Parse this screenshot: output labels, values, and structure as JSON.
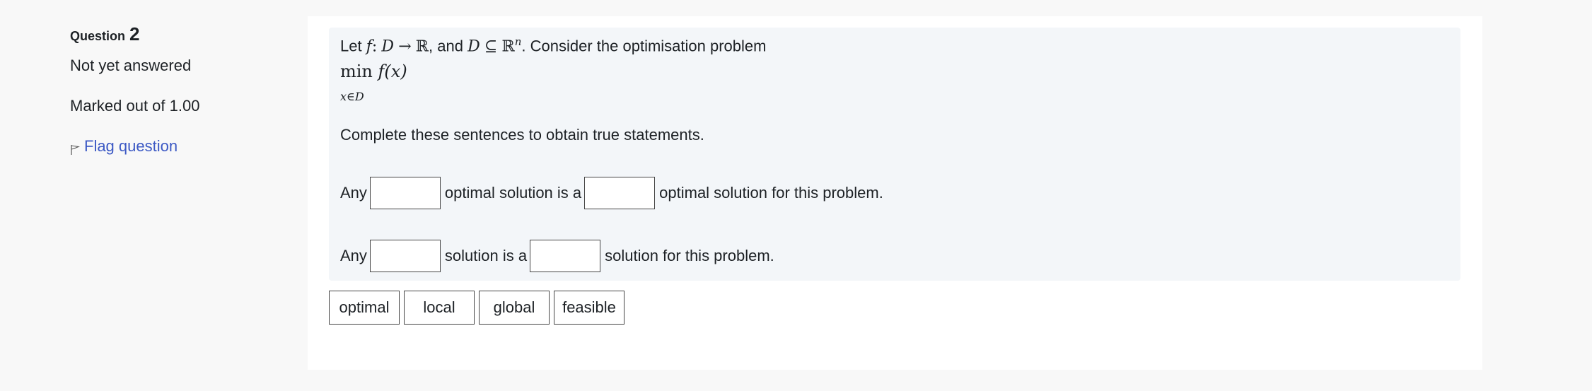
{
  "question_info": {
    "label": "Question",
    "number": "2",
    "state": "Not yet answered",
    "grade": "Marked out of 1.00",
    "flag_label": "Flag question"
  },
  "formulation": {
    "intro_prefix": "Let",
    "f": "f",
    "colon": ":",
    "D": "D",
    "arrow": "→",
    "R": "ℝ",
    "and_text": ", and",
    "D2": "D",
    "subseteq": "⊆",
    "Rn": "ℝ",
    "n_sup": "n",
    "intro_suffix": ". Consider the optimisation problem",
    "min_expr": "min",
    "fx": "f(x)",
    "min_sub": "x∈D",
    "prompt": "Complete these sentences to obtain true statements.",
    "sentence1": {
      "part1": "Any",
      "part2": "optimal solution is a",
      "part3": "optimal solution for this problem."
    },
    "sentence2": {
      "part1": "Any",
      "part2": "solution is a",
      "part3": "solution for this problem."
    }
  },
  "choices": [
    "optimal",
    "local",
    "global",
    "feasible"
  ],
  "colors": {
    "link": "#3b58c4",
    "formulation_bg": "#f3f6f9",
    "page_bg": "#f8f8f8"
  }
}
